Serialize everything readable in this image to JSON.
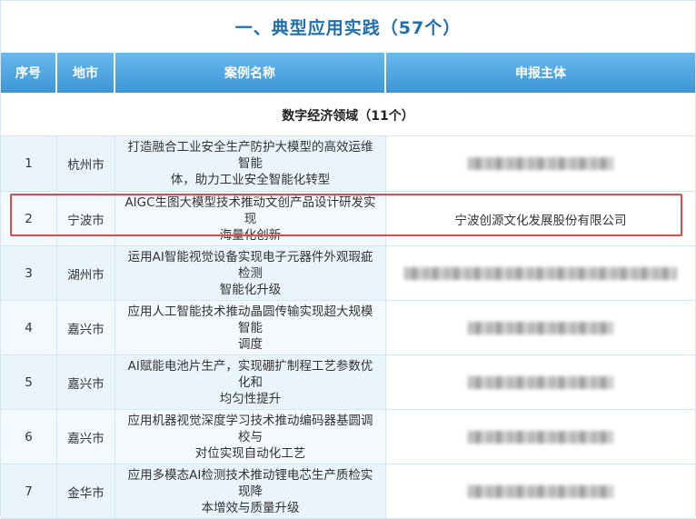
{
  "title": "一、典型应用实践（57个）",
  "headers": {
    "index": "序号",
    "city": "地市",
    "case": "案例名称",
    "org": "申报主体"
  },
  "section": "数字经济领域（11个）",
  "rows": [
    {
      "index": "1",
      "city": "杭州市",
      "case_lines": [
        "打造融合工业安全生产防护大模型的高效运维智能",
        "体，助力工业安全智能化转型"
      ],
      "org": "",
      "org_redacted": true
    },
    {
      "index": "2",
      "city": "宁波市",
      "case_lines": [
        "AIGC生图大模型技术推动文创产品设计研发实现",
        "海量化创新"
      ],
      "org": "宁波创源文化发展股份有限公司",
      "org_redacted": false
    },
    {
      "index": "3",
      "city": "湖州市",
      "case_lines": [
        "运用AI智能视觉设备实现电子元器件外观瑕疵检测",
        "智能化升级"
      ],
      "org": "",
      "org_redacted": true
    },
    {
      "index": "4",
      "city": "嘉兴市",
      "case_lines": [
        "应用人工智能技术推动晶圆传输实现超大规模智能",
        "调度"
      ],
      "org": "",
      "org_redacted": true
    },
    {
      "index": "5",
      "city": "嘉兴市",
      "case_lines": [
        "AI赋能电池片生产，实现硼扩制程工艺参数优化和",
        "均匀性提升"
      ],
      "org": "",
      "org_redacted": true
    },
    {
      "index": "6",
      "city": "嘉兴市",
      "case_lines": [
        "应用机器视觉深度学习技术推动编码器基圆调校与",
        "对位实现自动化工艺"
      ],
      "org": "",
      "org_redacted": true
    },
    {
      "index": "7",
      "city": "金华市",
      "case_lines": [
        "应用多模态AI检测技术推动锂电芯生产质检实现降",
        "本增效与质量升级"
      ],
      "org": "",
      "org_redacted": true
    }
  ],
  "highlight_color": "#e04a4a",
  "accent_color": "#3c96d6"
}
